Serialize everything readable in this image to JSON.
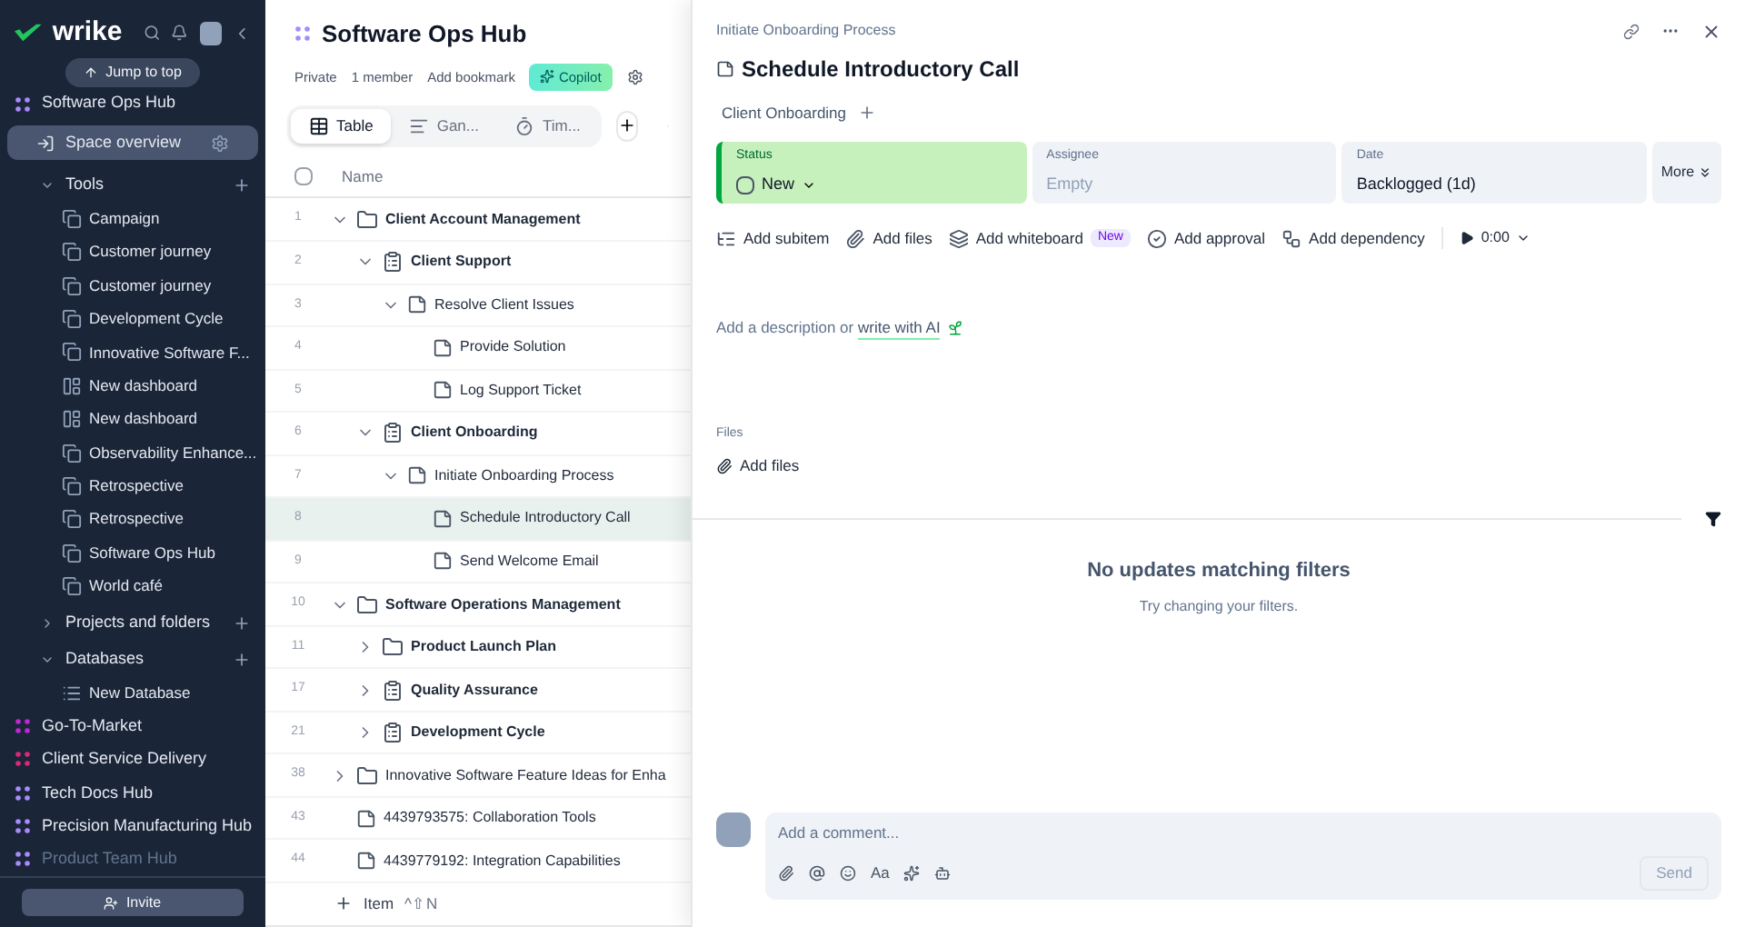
{
  "sidebar": {
    "logo": "wrike",
    "jump_button": "Jump to top",
    "spaces": [
      {
        "name": "Software Ops Hub",
        "color": "#a78bfa",
        "faded": false,
        "overview": {
          "label": "Space overview",
          "selected": true
        },
        "sections": [
          {
            "label": "Tools",
            "expanded": true,
            "children": [
              {
                "label": "Campaign",
                "kind": "whiteboard"
              },
              {
                "label": "Customer journey",
                "kind": "whiteboard"
              },
              {
                "label": "Customer journey",
                "kind": "whiteboard"
              },
              {
                "label": "Development Cycle",
                "kind": "whiteboard"
              },
              {
                "label": "Innovative Software F...",
                "kind": "whiteboard"
              },
              {
                "label": "New dashboard",
                "kind": "dashboard"
              },
              {
                "label": "New dashboard",
                "kind": "dashboard"
              },
              {
                "label": "Observability Enhance...",
                "kind": "whiteboard"
              },
              {
                "label": "Retrospective",
                "kind": "whiteboard"
              },
              {
                "label": "Retrospective",
                "kind": "whiteboard"
              },
              {
                "label": "Software Ops Hub",
                "kind": "whiteboard"
              },
              {
                "label": "World café",
                "kind": "whiteboard"
              }
            ]
          },
          {
            "label": "Projects and folders",
            "expanded": false
          },
          {
            "label": "Databases",
            "expanded": true,
            "children": [
              {
                "label": "New Database",
                "kind": "database"
              }
            ]
          }
        ]
      },
      {
        "name": "Go-To-Market",
        "color": "#c026d3",
        "faded": false
      },
      {
        "name": "Client Service Delivery",
        "color": "#db2777",
        "faded": false
      },
      {
        "name": "Tech Docs Hub",
        "color": "#a78bfa",
        "faded": false
      },
      {
        "name": "Precision Manufacturing Hub",
        "color": "#a78bfa",
        "faded": false
      },
      {
        "name": "Product Team Hub",
        "color": "#a78bfa",
        "faded": true
      }
    ],
    "invite_button": "Invite"
  },
  "main": {
    "title": "Software Ops Hub",
    "meta": [
      "Private",
      "1 member",
      "Add bookmark"
    ],
    "copilot": "Copilot",
    "tabs": [
      {
        "label": "Table",
        "kind": "table",
        "selected": true
      },
      {
        "label": "Gan...",
        "kind": "gantt",
        "selected": false
      },
      {
        "label": "Tim...",
        "kind": "timeline",
        "selected": false
      }
    ],
    "select_all": {
      "checked": false
    },
    "column": "Name",
    "rows": [
      {
        "number": "1",
        "label": "Client Account Management",
        "kind": "folder",
        "bold": true,
        "expanded": true,
        "selected": false,
        "children": [
          {
            "number": "2",
            "label": "Client Support",
            "kind": "project",
            "bold": true,
            "expanded": true,
            "selected": false,
            "children": [
              {
                "number": "3",
                "label": "Resolve Client Issues",
                "kind": "task",
                "bold": false,
                "expanded": true,
                "selected": false,
                "children": [
                  {
                    "number": "4",
                    "label": "Provide Solution",
                    "kind": "task",
                    "bold": false,
                    "selected": false
                  },
                  {
                    "number": "5",
                    "label": "Log Support Ticket",
                    "kind": "task",
                    "bold": false,
                    "selected": false
                  }
                ]
              }
            ]
          },
          {
            "number": "6",
            "label": "Client Onboarding",
            "kind": "project",
            "bold": true,
            "expanded": true,
            "selected": false,
            "children": [
              {
                "number": "7",
                "label": "Initiate Onboarding Process",
                "kind": "task",
                "bold": false,
                "expanded": true,
                "selected": false,
                "children": [
                  {
                    "number": "8",
                    "label": "Schedule Introductory Call",
                    "kind": "task",
                    "bold": false,
                    "selected": true
                  },
                  {
                    "number": "9",
                    "label": "Send Welcome Email",
                    "kind": "task",
                    "bold": false,
                    "selected": false
                  }
                ]
              }
            ]
          }
        ]
      },
      {
        "number": "10",
        "label": "Software Operations Management",
        "kind": "folder",
        "bold": true,
        "expanded": true,
        "selected": false,
        "children": [
          {
            "number": "11",
            "label": "Product Launch Plan",
            "kind": "folder",
            "bold": true,
            "expanded": false,
            "selected": false
          },
          {
            "number": "17",
            "label": "Quality Assurance",
            "kind": "project",
            "bold": true,
            "expanded": false,
            "selected": false
          },
          {
            "number": "21",
            "label": "Development Cycle",
            "kind": "project",
            "bold": true,
            "expanded": false,
            "selected": false
          }
        ]
      },
      {
        "number": "38",
        "label": "Innovative Software Feature Ideas for Enha",
        "kind": "folder",
        "bold": false,
        "expanded": false,
        "selected": false
      },
      {
        "number": "43",
        "label": "4439793575: Collaboration Tools",
        "kind": "task",
        "bold": false,
        "selected": false
      },
      {
        "number": "44",
        "label": "4439779192: Integration Capabilities",
        "kind": "task",
        "bold": false,
        "selected": false
      }
    ],
    "add_item": {
      "label": "Item",
      "shortcut": "^⇧N"
    }
  },
  "detail": {
    "breadcrumb": "Initiate Onboarding Process",
    "title": "Schedule Introductory Call",
    "tag": "Client Onboarding",
    "fields": [
      {
        "label": "Status",
        "value": "New",
        "kind": "status",
        "checked": false
      },
      {
        "label": "Assignee",
        "value": "Empty",
        "kind": "empty"
      },
      {
        "label": "Date",
        "value": "Backlogged (1d)",
        "kind": "text"
      }
    ],
    "more": "More",
    "actions": [
      {
        "label": "Add subitem",
        "kind": "subitem"
      },
      {
        "label": "Add files",
        "kind": "files"
      },
      {
        "label": "Add whiteboard",
        "kind": "whiteboard",
        "badge": "New"
      },
      {
        "label": "Add approval",
        "kind": "approval"
      },
      {
        "label": "Add dependency",
        "kind": "dependency"
      }
    ],
    "timer": "0:00",
    "description": {
      "text": "Add a description or ",
      "link": "write with AI"
    },
    "files_label": "Files",
    "add_files": "Add files",
    "empty_title": "No updates matching filters",
    "empty_hint": "Try changing your filters.",
    "comment": {
      "placeholder": "Add a comment...",
      "format": "Aa",
      "send": "Send"
    }
  }
}
